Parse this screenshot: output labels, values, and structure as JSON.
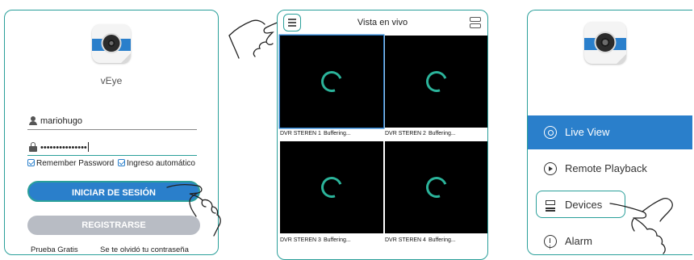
{
  "login": {
    "app_name": "vEye",
    "username_value": "mariohugo",
    "password_value": "•••••••••••••••",
    "remember_password": "Remember Password",
    "auto_login": "Ingreso automático",
    "login_button": "INICIAR DE SESIÓN",
    "register_button": "REGISTRARSE",
    "free_trial": "Prueba Gratis",
    "forgot_password": "Se te olvidó tu contraseña"
  },
  "live": {
    "title": "Vista en vivo",
    "tiles": [
      {
        "camera": "DVR STEREN 1",
        "status": "Buffering..."
      },
      {
        "camera": "DVR STEREN 2",
        "status": "Buffering..."
      },
      {
        "camera": "DVR STEREN 3",
        "status": "Buffering..."
      },
      {
        "camera": "DVR STEREN 4",
        "status": "Buffering..."
      }
    ]
  },
  "menu": {
    "items": [
      {
        "label": "Live View",
        "icon": "live-view-icon",
        "selected": true
      },
      {
        "label": "Remote Playback",
        "icon": "play-circle-icon"
      },
      {
        "label": "Devices",
        "icon": "devices-icon"
      },
      {
        "label": "Alarm",
        "icon": "alarm-icon"
      }
    ]
  },
  "colors": {
    "accent": "#2a7fcb",
    "outline": "#2a9f9a",
    "spinner": "#2bb39a",
    "disabled_button": "#b8bcc4"
  }
}
